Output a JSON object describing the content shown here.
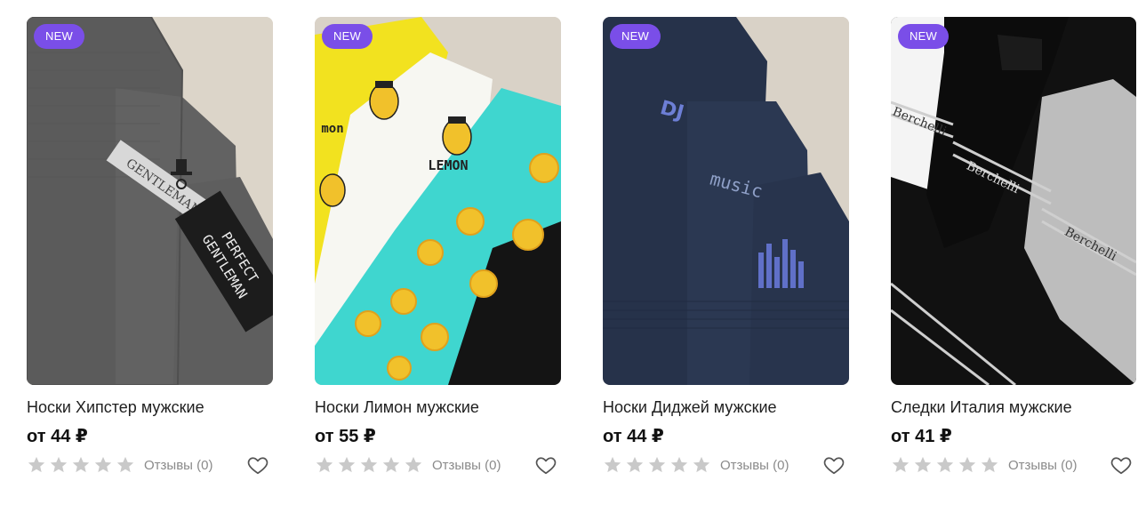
{
  "currency": "₽",
  "products": [
    {
      "badge": "NEW",
      "title": "Носки Хипстер мужские",
      "price": "от 44 ₽",
      "reviews": "Отзывы (0)",
      "rating": 0,
      "image": "grey-gentleman-socks"
    },
    {
      "badge": "NEW",
      "title": "Носки Лимон мужские",
      "price": "от 55 ₽",
      "reviews": "Отзывы (0)",
      "rating": 0,
      "image": "lemon-socks"
    },
    {
      "badge": "NEW",
      "title": "Носки Диджей мужские",
      "price": "от 44 ₽",
      "reviews": "Отзывы (0)",
      "rating": 0,
      "image": "dj-music-socks"
    },
    {
      "badge": "NEW",
      "title": "Следки Италия мужские",
      "price": "от 41 ₽",
      "reviews": "Отзывы (0)",
      "rating": 0,
      "image": "berchelli-no-show-socks"
    }
  ],
  "photo_text": {
    "p1": [
      "PERFECT",
      "GENTLEMAN"
    ],
    "p1b": "GENTLEMAN",
    "p2": [
      "LEMON",
      "mon"
    ],
    "p3": [
      "DJ",
      "music"
    ],
    "p4": "Berchelli"
  },
  "colors": {
    "badge": "#7a4ee8",
    "star_empty": "#c9c9c9",
    "heart": "#555555",
    "title": "#1f1f1f",
    "price": "#111111"
  }
}
